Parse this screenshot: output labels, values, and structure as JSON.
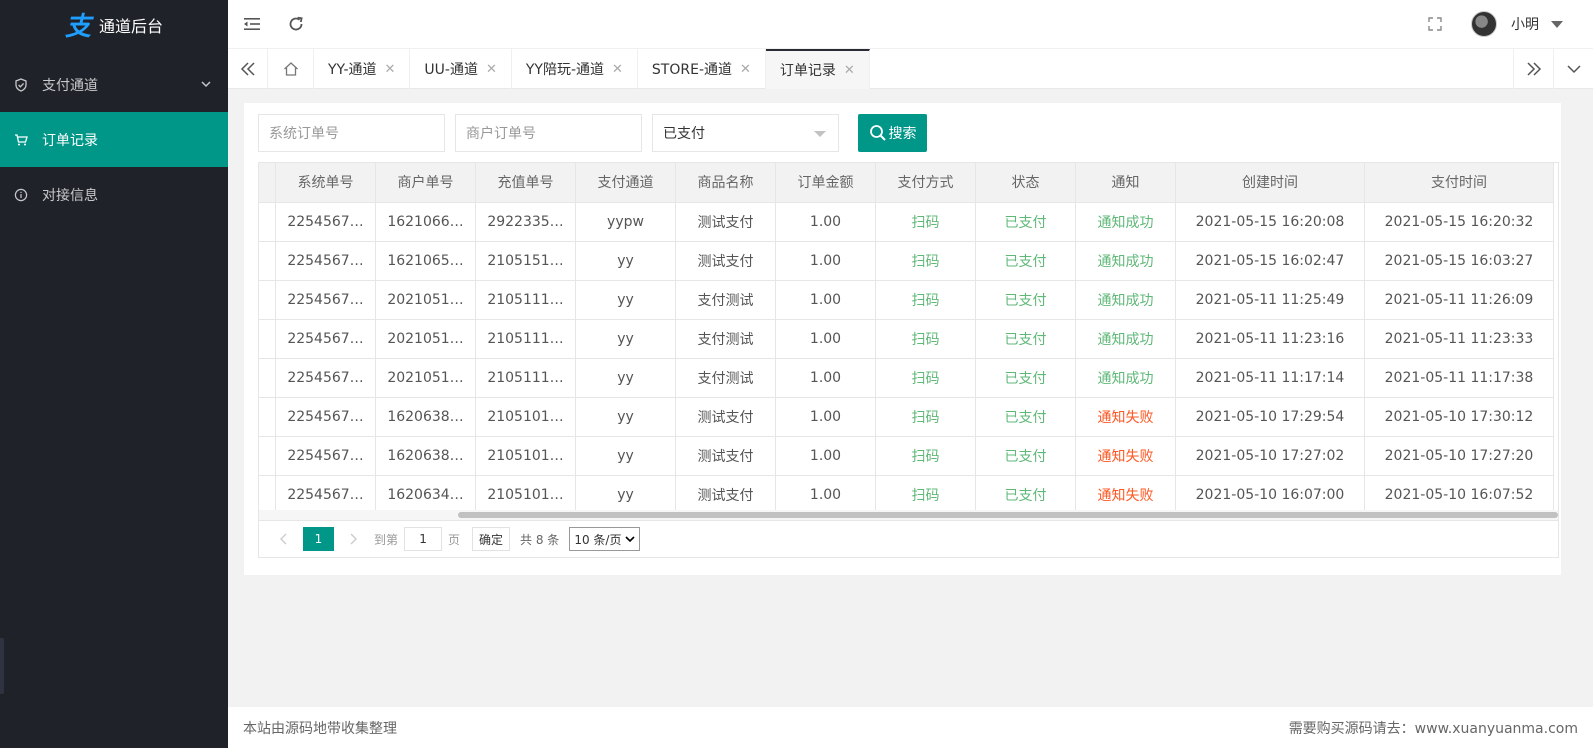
{
  "app": {
    "logo_char": "支",
    "title": "通道后台"
  },
  "sidebar": {
    "items": [
      {
        "label": "支付通道",
        "icon": "shield-icon"
      },
      {
        "label": "订单记录",
        "icon": "cart-icon"
      },
      {
        "label": "对接信息",
        "icon": "info-icon"
      }
    ]
  },
  "header": {
    "user_name": "小明"
  },
  "tabs": [
    {
      "label": "YY-通道"
    },
    {
      "label": "UU-通道"
    },
    {
      "label": "YY陪玩-通道"
    },
    {
      "label": "STORE-通道"
    },
    {
      "label": "订单记录"
    }
  ],
  "filters": {
    "sys_order_placeholder": "系统订单号",
    "merchant_order_placeholder": "商户订单号",
    "status_value": "已支付",
    "search_label": "搜索"
  },
  "table": {
    "headers": [
      "系统单号",
      "商户单号",
      "充值单号",
      "支付通道",
      "商品名称",
      "订单金额",
      "支付方式",
      "状态",
      "通知",
      "创建时间",
      "支付时间"
    ],
    "rows": [
      [
        "2254567…",
        "1621066…",
        "2922335…",
        "yypw",
        "测试支付",
        "1.00",
        "扫码",
        "已支付",
        "通知成功",
        "2021-05-15 16:20:08",
        "2021-05-15 16:20:32"
      ],
      [
        "2254567…",
        "1621065…",
        "2105151…",
        "yy",
        "测试支付",
        "1.00",
        "扫码",
        "已支付",
        "通知成功",
        "2021-05-15 16:02:47",
        "2021-05-15 16:03:27"
      ],
      [
        "2254567…",
        "2021051…",
        "2105111…",
        "yy",
        "支付测试",
        "1.00",
        "扫码",
        "已支付",
        "通知成功",
        "2021-05-11 11:25:49",
        "2021-05-11 11:26:09"
      ],
      [
        "2254567…",
        "2021051…",
        "2105111…",
        "yy",
        "支付测试",
        "1.00",
        "扫码",
        "已支付",
        "通知成功",
        "2021-05-11 11:23:16",
        "2021-05-11 11:23:33"
      ],
      [
        "2254567…",
        "2021051…",
        "2105111…",
        "yy",
        "支付测试",
        "1.00",
        "扫码",
        "已支付",
        "通知成功",
        "2021-05-11 11:17:14",
        "2021-05-11 11:17:38"
      ],
      [
        "2254567…",
        "1620638…",
        "2105101…",
        "yy",
        "测试支付",
        "1.00",
        "扫码",
        "已支付",
        "通知失败",
        "2021-05-10 17:29:54",
        "2021-05-10 17:30:12"
      ],
      [
        "2254567…",
        "1620638…",
        "2105101…",
        "yy",
        "测试支付",
        "1.00",
        "扫码",
        "已支付",
        "通知失败",
        "2021-05-10 17:27:02",
        "2021-05-10 17:27:20"
      ],
      [
        "2254567…",
        "1620634…",
        "2105101…",
        "yy",
        "测试支付",
        "1.00",
        "扫码",
        "已支付",
        "通知失败",
        "2021-05-10 16:07:00",
        "2021-05-10 16:07:52"
      ]
    ]
  },
  "pager": {
    "current_page": "1",
    "goto_label": "到第",
    "goto_value": "1",
    "page_label": "页",
    "confirm_label": "确定",
    "total_label": "共 8 条",
    "page_size_label": "10 条/页"
  },
  "footer": {
    "left": "本站由源码地带收集整理",
    "right": "需要购买源码请去：www.xuanyuanma.com"
  },
  "colors": {
    "accent": "#009688",
    "sidebar_bg": "#20222a",
    "success": "#5fb878",
    "fail": "#ff5722"
  }
}
